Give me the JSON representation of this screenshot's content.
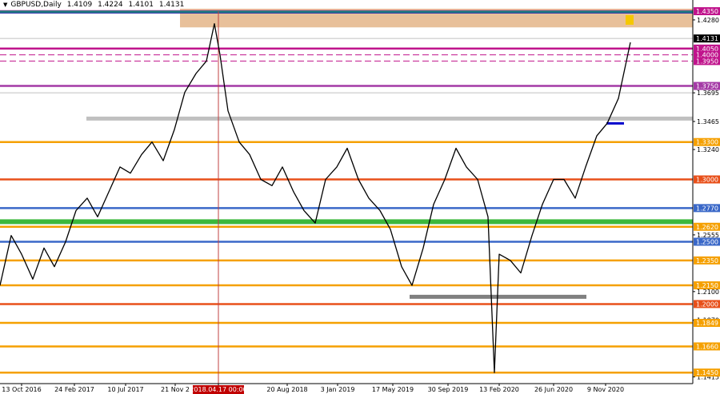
{
  "header": {
    "symbol_timeframe": "GBPUSD,Daily",
    "open": "1.4109",
    "high": "1.4224",
    "low": "1.4101",
    "close": "1.4131"
  },
  "chart_data": {
    "type": "line",
    "symbol": "GBPUSD",
    "timeframe": "Daily",
    "ohlc": {
      "open": 1.4109,
      "high": 1.4224,
      "low": 1.4101,
      "close": 1.4131
    },
    "current_price": 1.4131,
    "current_price_label": "1.4131",
    "ylim": [
      1.14,
      1.435
    ],
    "x_tick_labels": [
      "13 Oct 2016",
      "24 Feb 2017",
      "10 Jul 2017",
      "21 Nov 2",
      "2018.04.17 00:00",
      "20 Aug 2018",
      "3 Jan 2019",
      "17 May 2019",
      "30 Sep 2019",
      "13 Feb 2020",
      "26 Jun 2020",
      "9 Nov 2020"
    ],
    "crosshair_date": "2018.04.17 00:00",
    "price_axis_ticks": [
      {
        "value": 1.428,
        "label": "1.4280"
      },
      {
        "value": 1.3695,
        "label": "1.3695"
      },
      {
        "value": 1.3465,
        "label": "1.3465"
      },
      {
        "value": 1.324,
        "label": "1.3240"
      },
      {
        "value": 1.2555,
        "label": "1.2555"
      },
      {
        "value": 1.21,
        "label": "1.2100"
      },
      {
        "value": 1.187,
        "label": "1.1870"
      },
      {
        "value": 1.1415,
        "label": "1.1415"
      }
    ],
    "levels": [
      {
        "value": 1.435,
        "label": "1.4350",
        "color": "#c0148c",
        "style": "solid"
      },
      {
        "value": 1.405,
        "label": "1.4050",
        "color": "#c0148c",
        "style": "solid"
      },
      {
        "value": 1.4,
        "label": "1.4000",
        "color": "#c0148c",
        "style": "dashed"
      },
      {
        "value": 1.395,
        "label": "1.3950",
        "color": "#c0148c",
        "style": "dashed"
      },
      {
        "value": 1.375,
        "label": "1.3750",
        "color": "#a43aa6",
        "style": "solid"
      },
      {
        "value": 1.33,
        "label": "1.3300",
        "color": "#f5a000",
        "style": "solid"
      },
      {
        "value": 1.3,
        "label": "1.3000",
        "color": "#e8501a",
        "style": "solid"
      },
      {
        "value": 1.277,
        "label": "1.2770",
        "color": "#3a68c8",
        "style": "solid"
      },
      {
        "value": 1.262,
        "label": "1.2620",
        "color": "#f5a000",
        "style": "solid"
      },
      {
        "value": 1.25,
        "label": "1.2500",
        "color": "#3a68c8",
        "style": "solid"
      },
      {
        "value": 1.235,
        "label": "1.2350",
        "color": "#f5a000",
        "style": "solid"
      },
      {
        "value": 1.215,
        "label": "1.2150",
        "color": "#f5a000",
        "style": "solid"
      },
      {
        "value": 1.2,
        "label": "1.2000",
        "color": "#e8501a",
        "style": "solid"
      },
      {
        "value": 1.1849,
        "label": "1.1849",
        "color": "#f5a000",
        "style": "solid"
      },
      {
        "value": 1.166,
        "label": "1.1660",
        "color": "#f5a000",
        "style": "solid"
      },
      {
        "value": 1.145,
        "label": "1.1450",
        "color": "#f5a000",
        "style": "solid"
      }
    ],
    "resistance_zone": {
      "from": 1.422,
      "to": 1.437,
      "color": "#e8c09a"
    },
    "path": [
      [
        0,
        1.215
      ],
      [
        14,
        1.255
      ],
      [
        27,
        1.24
      ],
      [
        41,
        1.22
      ],
      [
        55,
        1.245
      ],
      [
        68,
        1.23
      ],
      [
        82,
        1.25
      ],
      [
        95,
        1.275
      ],
      [
        109,
        1.285
      ],
      [
        122,
        1.27
      ],
      [
        136,
        1.29
      ],
      [
        150,
        1.31
      ],
      [
        163,
        1.305
      ],
      [
        177,
        1.32
      ],
      [
        190,
        1.33
      ],
      [
        204,
        1.315
      ],
      [
        218,
        1.34
      ],
      [
        231,
        1.37
      ],
      [
        245,
        1.385
      ],
      [
        258,
        1.395
      ],
      [
        268,
        1.425
      ],
      [
        275,
        1.4
      ],
      [
        285,
        1.355
      ],
      [
        299,
        1.33
      ],
      [
        312,
        1.32
      ],
      [
        326,
        1.3
      ],
      [
        340,
        1.295
      ],
      [
        353,
        1.31
      ],
      [
        367,
        1.29
      ],
      [
        380,
        1.275
      ],
      [
        394,
        1.265
      ],
      [
        407,
        1.3
      ],
      [
        421,
        1.31
      ],
      [
        434,
        1.325
      ],
      [
        448,
        1.3
      ],
      [
        461,
        1.285
      ],
      [
        475,
        1.275
      ],
      [
        488,
        1.26
      ],
      [
        502,
        1.23
      ],
      [
        515,
        1.215
      ],
      [
        529,
        1.245
      ],
      [
        542,
        1.28
      ],
      [
        556,
        1.3
      ],
      [
        570,
        1.325
      ],
      [
        583,
        1.31
      ],
      [
        597,
        1.3
      ],
      [
        610,
        1.27
      ],
      [
        618,
        1.145
      ],
      [
        624,
        1.24
      ],
      [
        638,
        1.235
      ],
      [
        651,
        1.225
      ],
      [
        665,
        1.255
      ],
      [
        678,
        1.28
      ],
      [
        692,
        1.3
      ],
      [
        705,
        1.3
      ],
      [
        719,
        1.285
      ],
      [
        732,
        1.31
      ],
      [
        746,
        1.335
      ],
      [
        759,
        1.345
      ],
      [
        773,
        1.365
      ],
      [
        788,
        1.41
      ]
    ]
  }
}
